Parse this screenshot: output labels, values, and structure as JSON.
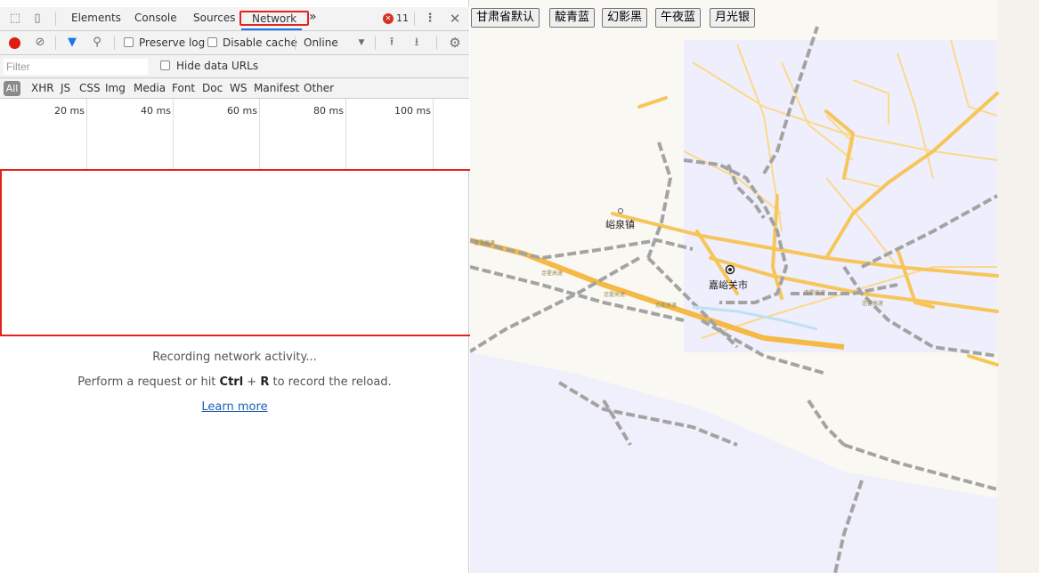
{
  "devtools": {
    "tabs": [
      "Elements",
      "Console",
      "Sources",
      "Network"
    ],
    "more_tabs": "»",
    "error_count": "11",
    "toolbar": {
      "preserve_log": "Preserve log",
      "disable_cache": "Disable cache",
      "throttling": "Online"
    },
    "filter": {
      "placeholder": "Filter",
      "hide_data_urls": "Hide data URLs"
    },
    "types": [
      "All",
      "XHR",
      "JS",
      "CSS",
      "Img",
      "Media",
      "Font",
      "Doc",
      "WS",
      "Manifest",
      "Other"
    ],
    "timeline_labels": [
      "20 ms",
      "40 ms",
      "60 ms",
      "80 ms",
      "100 ms"
    ],
    "empty_state": {
      "line1": "Recording network activity...",
      "line2_prefix": "Perform a request or hit ",
      "line2_key1": "Ctrl",
      "line2_plus": " + ",
      "line2_key2": "R",
      "line2_suffix": " to record the reload.",
      "learn_more": "Learn more"
    }
  },
  "map": {
    "style_buttons": [
      "甘肃省默认",
      "靛青蓝",
      "幻影黑",
      "午夜蓝",
      "月光银"
    ],
    "places": {
      "town": "峪泉镇",
      "city": "嘉峪关市"
    },
    "road_label": "连霍高速",
    "colors": {
      "expressway": "#f7c65a",
      "road": "#fbd98a",
      "railway": "#9a9a9a",
      "district": "#efeefc",
      "land": "#f9f8f2"
    }
  }
}
